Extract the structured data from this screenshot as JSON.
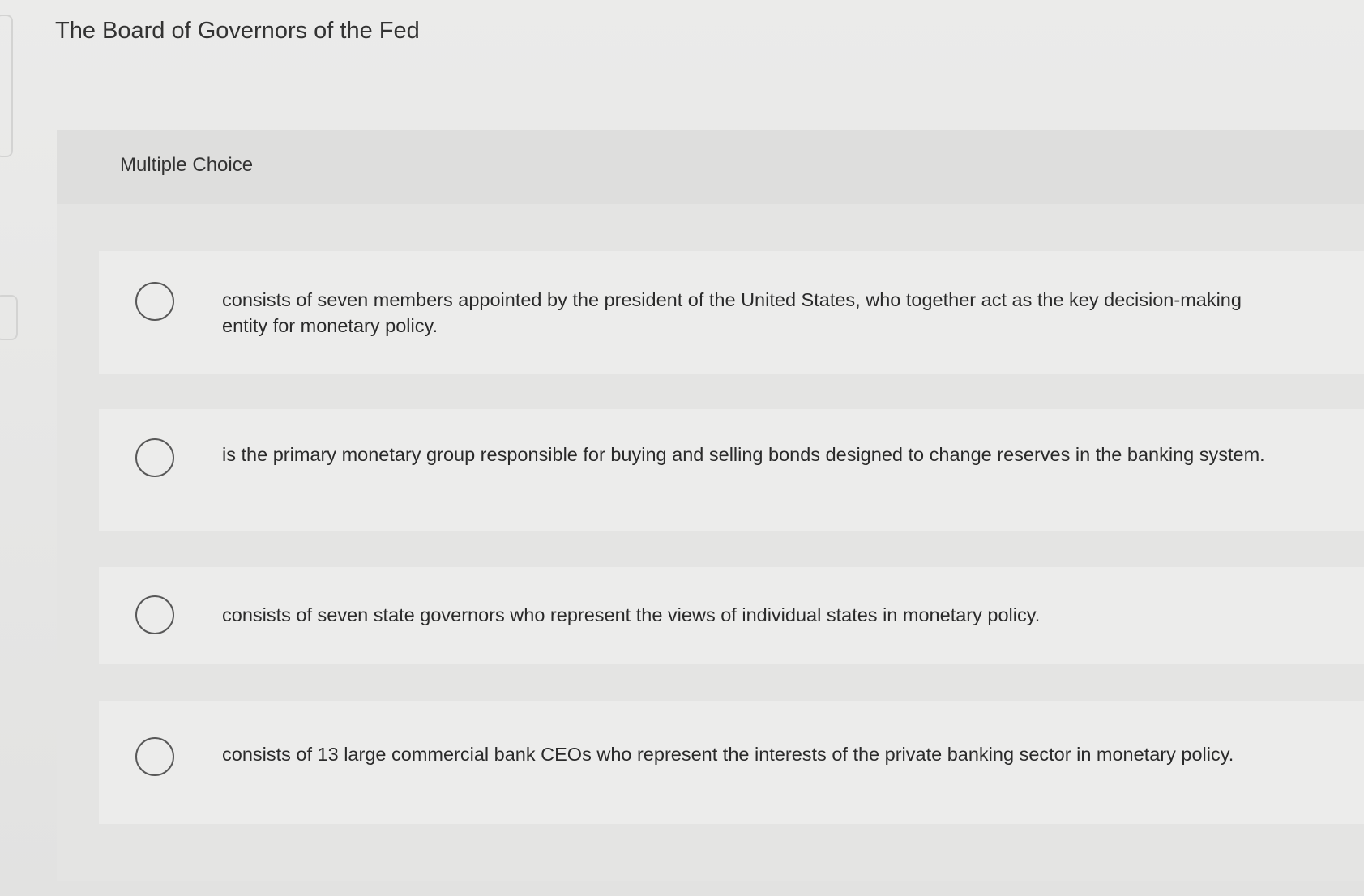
{
  "question": {
    "prompt": "The Board of Governors of the Fed",
    "type_label": "Multiple Choice"
  },
  "choices": [
    {
      "text": "consists of seven members appointed by the president of the United States, who together act as the key decision-making entity for monetary policy.",
      "selected": false
    },
    {
      "text": "is the primary monetary group responsible for buying and selling bonds designed to change reserves in the banking system.",
      "selected": false
    },
    {
      "text": "consists of seven state governors who represent the views of individual states in monetary policy.",
      "selected": false
    },
    {
      "text": "consists of 13 large commercial bank CEOs who represent the interests of the private banking sector in monetary policy.",
      "selected": false
    }
  ]
}
